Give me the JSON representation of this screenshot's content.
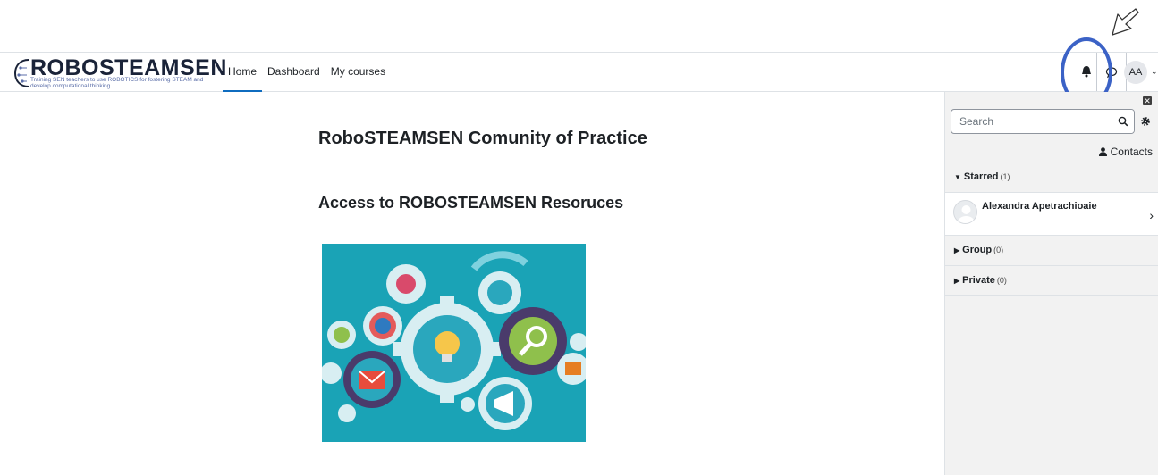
{
  "logo": {
    "title": "ROBOSTEAMSEN",
    "tagline": "Training SEN teachers to use ROBOTICS for fostering STEAM and develop computational thinking"
  },
  "nav": {
    "links": [
      "Home",
      "Dashboard",
      "My courses"
    ],
    "active": "Home"
  },
  "user": {
    "initials": "AA"
  },
  "main": {
    "title": "RoboSTEAMSEN Comunity of Practice",
    "subtitle": "Access to ROBOSTEAMSEN Resoruces"
  },
  "drawer": {
    "search_placeholder": "Search",
    "contacts_label": "Contacts",
    "sections": [
      {
        "label": "Starred",
        "count": "(1)",
        "expanded": true
      },
      {
        "label": "Group",
        "count": "(0)",
        "expanded": false
      },
      {
        "label": "Private",
        "count": "(0)",
        "expanded": false
      }
    ],
    "starred_contacts": [
      {
        "name": "Alexandra Apetrachioaie"
      }
    ]
  },
  "colors": {
    "accent": "#0f6cbf",
    "highlight": "#3b62c6",
    "drawer_bg": "#f2f2f2",
    "gears_bg": "#1aa3b6"
  }
}
